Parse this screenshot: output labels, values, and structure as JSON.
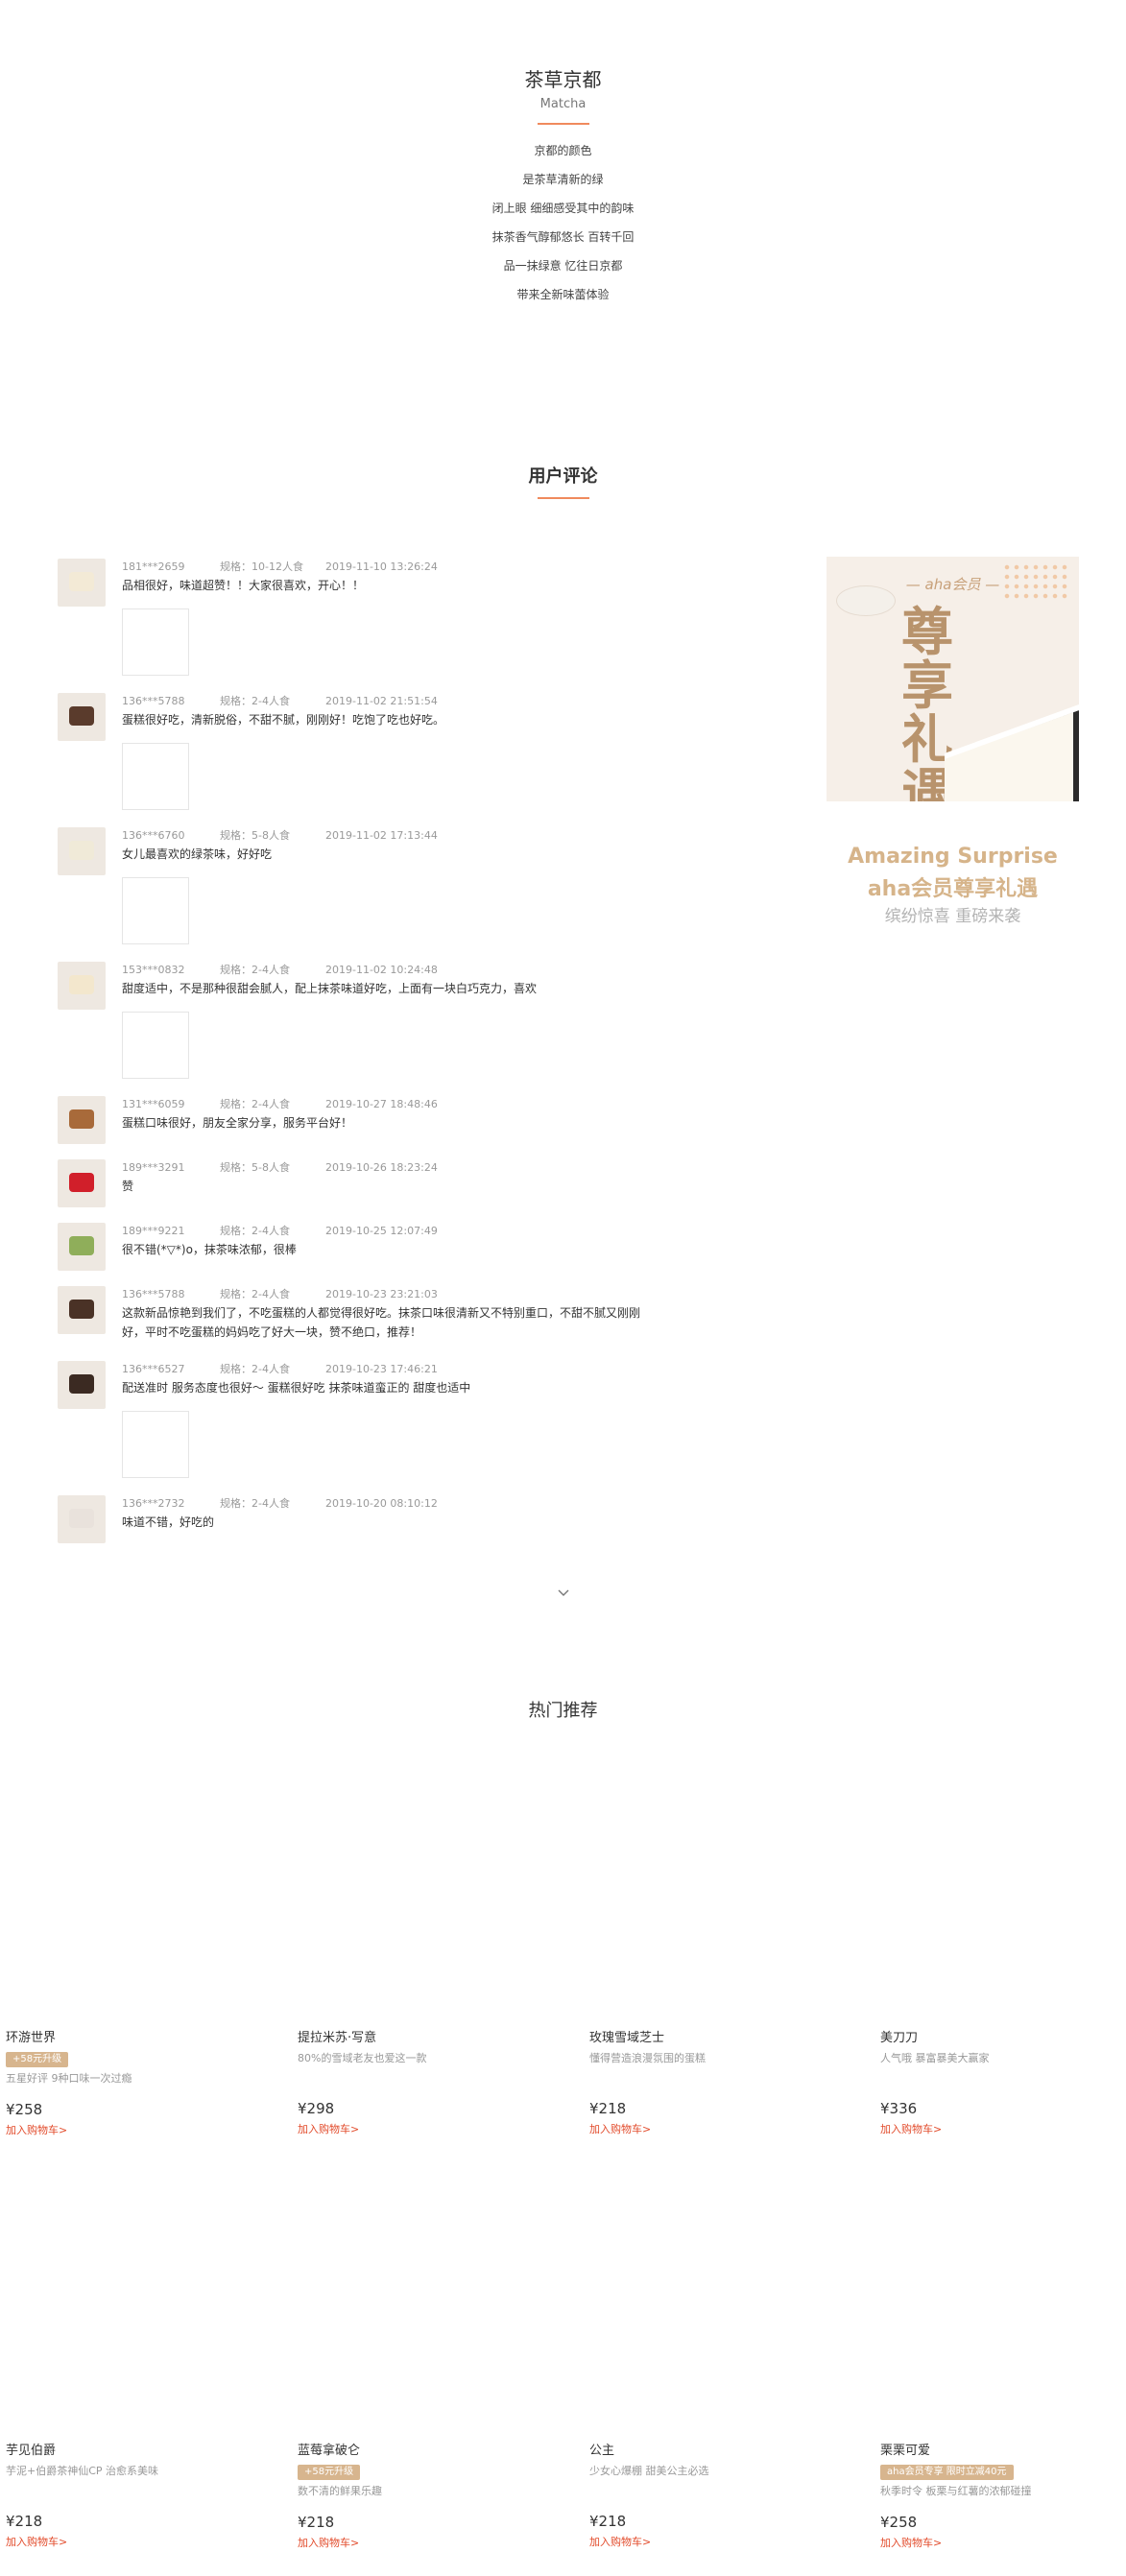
{
  "intro": {
    "title": "茶草京都",
    "subtitle": "Matcha",
    "lines": [
      "京都的颜色",
      "是茶草清新的绿",
      "闭上眼 细细感受其中的韵味",
      "抹茶香气醇郁悠长 百转千回",
      "品一抹绿意 忆往日京都",
      "带来全新味蕾体验"
    ]
  },
  "reviews": {
    "title": "用户评论",
    "spec_prefix": "规格：",
    "items": [
      {
        "user": "181***2659",
        "spec": "10-12人食",
        "time": "2019-11-10 13:26:24",
        "text": "品相很好，味道超赞！！大家很喜欢，开心！！"
      },
      {
        "user": "136***5788",
        "spec": "2-4人食",
        "time": "2019-11-02 21:51:54",
        "text": "蛋糕很好吃，清新脱俗，不甜不腻，刚刚好！吃饱了吃也好吃。"
      },
      {
        "user": "136***6760",
        "spec": "5-8人食",
        "time": "2019-11-02 17:13:44",
        "text": "女儿最喜欢的绿茶味，好好吃"
      },
      {
        "user": "153***0832",
        "spec": "2-4人食",
        "time": "2019-11-02 10:24:48",
        "text": "甜度适中，不是那种很甜会腻人，配上抹茶味道好吃，上面有一块白巧克力，喜欢"
      },
      {
        "user": "131***6059",
        "spec": "2-4人食",
        "time": "2019-10-27 18:48:46",
        "text": "蛋糕口味很好，朋友全家分享，服务平台好！"
      },
      {
        "user": "189***3291",
        "spec": "5-8人食",
        "time": "2019-10-26 18:23:24",
        "text": "赞"
      },
      {
        "user": "189***9221",
        "spec": "2-4人食",
        "time": "2019-10-25 12:07:49",
        "text": "很不错(*▽*)o，抹茶味浓郁，很棒"
      },
      {
        "user": "136***5788",
        "spec": "2-4人食",
        "time": "2019-10-23 23:21:03",
        "text": "这款新品惊艳到我们了，不吃蛋糕的人都觉得很好吃。抹茶口味很清新又不特别重口，不甜不腻又刚刚好，平时不吃蛋糕的妈妈吃了好大一块，赞不绝口，推荐！"
      },
      {
        "user": "136***6527",
        "spec": "2-4人食",
        "time": "2019-10-23 17:46:21",
        "text": "配送准时 服务态度也很好～ 蛋糕很好吃 抹茶味道蛮正的 甜度也适中"
      },
      {
        "user": "136***2732",
        "spec": "2-4人食",
        "time": "2019-10-20 08:10:12",
        "text": "味道不错，好吃的"
      }
    ]
  },
  "banner": {
    "brand": "— aha会员 —",
    "big_text": "尊享礼遇",
    "line1": "Amazing Surprise",
    "line2": "aha会员尊享礼遇",
    "line3": "缤纷惊喜 重磅来袭"
  },
  "recommend": {
    "title": "热门推荐",
    "cart_label": "加入购物车>",
    "products": [
      {
        "name": "环游世界",
        "badge": "+58元升级",
        "desc": "五星好评 9种口味一次过瘾",
        "price": "¥258"
      },
      {
        "name": "提拉米苏·写意",
        "badge": "",
        "desc": "80%的雪域老友也爱这一款",
        "price": "¥298"
      },
      {
        "name": "玫瑰雪域芝士",
        "badge": "",
        "desc": "懂得营造浪漫氛围的蛋糕",
        "price": "¥218"
      },
      {
        "name": "美刀刀",
        "badge": "",
        "desc": "人气哦 暴富暴美大赢家",
        "price": "¥336"
      },
      {
        "name": "芋见伯爵",
        "badge": "",
        "desc": "芋泥+伯爵茶神仙CP 治愈系美味",
        "price": "¥218"
      },
      {
        "name": "蓝莓拿破仑",
        "badge": "+58元升级",
        "desc": "数不清的鲜果乐趣",
        "price": "¥218"
      },
      {
        "name": "公主",
        "badge": "",
        "desc": "少女心爆棚 甜美公主必选",
        "price": "¥218"
      },
      {
        "name": "栗栗可爱",
        "badge": "aha会员专享 限时立减40元",
        "desc": "秋季时令 板栗与红薯的浓郁碰撞",
        "price": "¥258"
      }
    ]
  },
  "colors": {
    "accent": "#f08a5d",
    "cart": "#e24a2a",
    "badge": "#d7b58e",
    "banner_gold": "#d6b48a"
  },
  "icons": {
    "more": "chevron-down-icon"
  }
}
